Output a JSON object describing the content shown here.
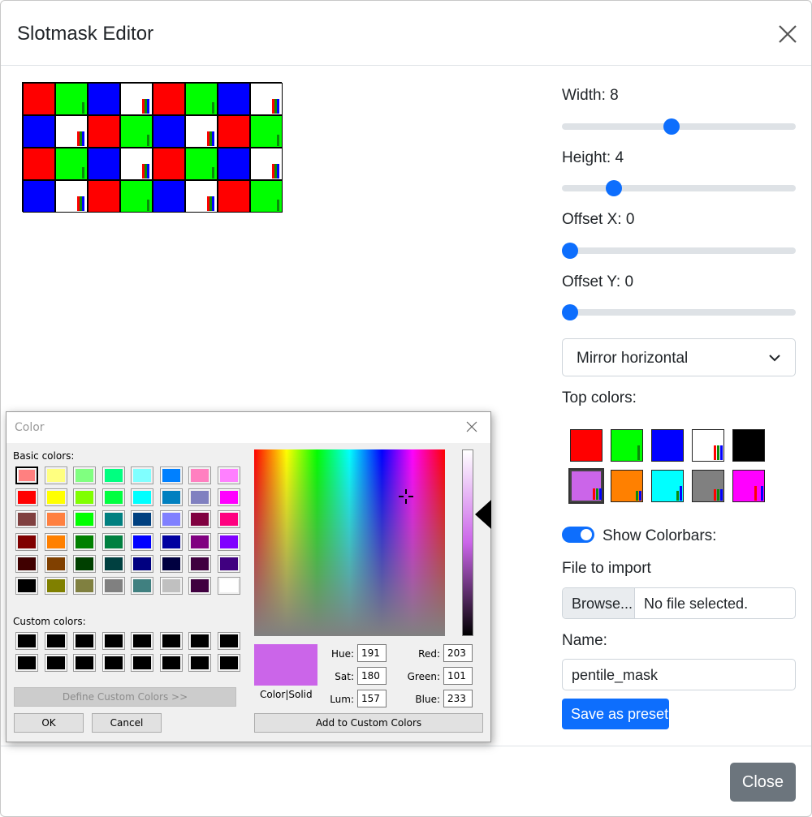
{
  "modal": {
    "title": "Slotmask Editor",
    "close_label": "Close"
  },
  "mask": {
    "rows": [
      [
        "red",
        "green",
        "blue",
        "white",
        "red",
        "green",
        "blue",
        "white"
      ],
      [
        "blue",
        "white",
        "red",
        "green",
        "blue",
        "white",
        "red",
        "green"
      ],
      [
        "red",
        "green",
        "blue",
        "white",
        "red",
        "green",
        "blue",
        "white"
      ],
      [
        "blue",
        "white",
        "red",
        "green",
        "blue",
        "white",
        "red",
        "green"
      ]
    ]
  },
  "controls": {
    "width_label": "Width: 8",
    "width_value": 8,
    "height_label": "Height: 4",
    "height_value": 4,
    "offset_x_label": "Offset X: 0",
    "offset_x_value": 0,
    "offset_y_label": "Offset Y: 0",
    "offset_y_value": 0,
    "mirror_select": "Mirror horizontal",
    "top_colors_label": "Top colors:",
    "show_colorbars_label": "Show Colorbars:",
    "show_colorbars": true,
    "file_import_label": "File to import",
    "browse_label": "Browse...",
    "file_status": "No file selected.",
    "name_label": "Name:",
    "name_value": "pentile_mask",
    "save_preset_label": "Save as preset"
  },
  "top_colors": [
    {
      "name": "red",
      "color": "#ff0000"
    },
    {
      "name": "green",
      "color": "#00ff00"
    },
    {
      "name": "blue",
      "color": "#0000ff"
    },
    {
      "name": "white",
      "color": "#ffffff"
    },
    {
      "name": "black",
      "color": "#000000"
    },
    {
      "name": "purple",
      "color": "#cb65e9",
      "selected": true
    },
    {
      "name": "orange",
      "color": "#ff8000"
    },
    {
      "name": "cyan",
      "color": "#00ffff"
    },
    {
      "name": "gray",
      "color": "#808080"
    },
    {
      "name": "magenta",
      "color": "#ff00ff"
    }
  ],
  "color_dialog": {
    "title": "Color",
    "basic_colors_label": "Basic colors:",
    "custom_colors_label": "Custom colors:",
    "define_custom_label": "Define Custom Colors >>",
    "ok_label": "OK",
    "cancel_label": "Cancel",
    "color_solid_label": "Color|Solid",
    "add_custom_label": "Add to Custom Colors",
    "hue_label": "Hue:",
    "sat_label": "Sat:",
    "lum_label": "Lum:",
    "red_label": "Red:",
    "green_label": "Green:",
    "blue_label": "Blue:",
    "hue": "191",
    "sat": "180",
    "lum": "157",
    "red": "203",
    "green": "101",
    "blue": "233",
    "basic_colors": [
      "#ff8080",
      "#ffff80",
      "#80ff80",
      "#00ff80",
      "#80ffff",
      "#0080ff",
      "#ff80c0",
      "#ff80ff",
      "#ff0000",
      "#ffff00",
      "#80ff00",
      "#00ff40",
      "#00ffff",
      "#0080c0",
      "#8080c0",
      "#ff00ff",
      "#804040",
      "#ff8040",
      "#00ff00",
      "#008080",
      "#004080",
      "#8080ff",
      "#800040",
      "#ff0080",
      "#800000",
      "#ff8000",
      "#008000",
      "#008040",
      "#0000ff",
      "#0000a0",
      "#800080",
      "#8000ff",
      "#400000",
      "#804000",
      "#004000",
      "#004040",
      "#000080",
      "#000040",
      "#400040",
      "#400080",
      "#000000",
      "#808000",
      "#808040",
      "#808080",
      "#408080",
      "#c0c0c0",
      "#400040",
      "#ffffff"
    ],
    "custom_colors": [
      "#000000",
      "#000000",
      "#000000",
      "#000000",
      "#000000",
      "#000000",
      "#000000",
      "#000000",
      "#000000",
      "#000000",
      "#000000",
      "#000000",
      "#000000",
      "#000000",
      "#000000",
      "#000000"
    ]
  }
}
